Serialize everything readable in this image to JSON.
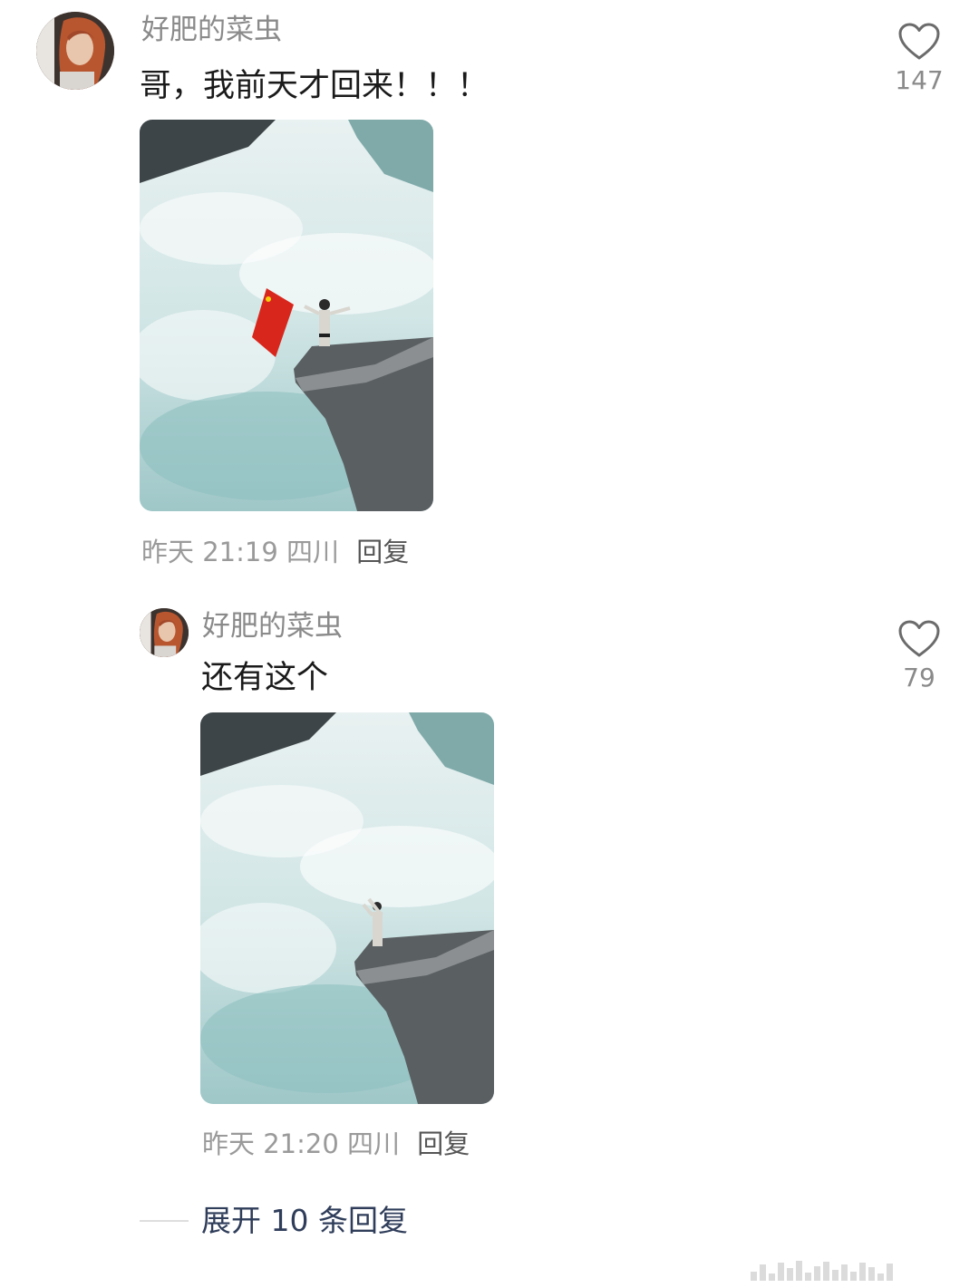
{
  "comments": [
    {
      "author": "好肥的菜虫",
      "text": "哥，我前天才回来！！！",
      "time": "昨天 21:19",
      "location": "四川",
      "reply_label": "回复",
      "likes": "147",
      "photo": "flag-cliff-photo"
    },
    {
      "author": "好肥的菜虫",
      "text": "还有这个",
      "time": "昨天 21:20",
      "location": "四川",
      "reply_label": "回复",
      "likes": "79",
      "photo": "cliff-photo"
    }
  ],
  "expand_replies": "展开 10 条回复",
  "icons": {
    "like": "heart-outline-icon"
  },
  "colors": {
    "author": "#8a8a8a",
    "text": "#1a1a1a",
    "meta": "#9a9a9a",
    "link": "#2f3d5a",
    "flag": "#d9261c"
  }
}
